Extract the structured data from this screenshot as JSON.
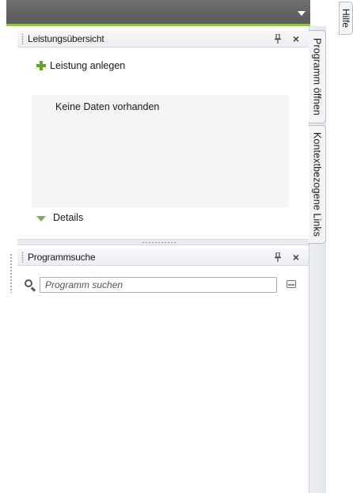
{
  "header": {
    "menu_icon": "chevron-down-icon"
  },
  "right_tabs": {
    "program_open": "Programm öffnen",
    "context_links": "Kontextbezogene Links",
    "help": "Hilfe"
  },
  "panel_services": {
    "title": "Leistungsübersicht",
    "pin_icon": "pin-icon",
    "close_label": "×",
    "add_label": "Leistung anlegen",
    "empty_text": "Keine Daten vorhanden",
    "details_label": "Details"
  },
  "panel_search": {
    "title": "Programmsuche",
    "close_label": "×",
    "search_placeholder": "Programm suchen",
    "search_value": ""
  },
  "colors": {
    "header_bg": "#5f5f5f",
    "accent_green": "#8fc34a",
    "add_icon_green": "#58a82a"
  }
}
